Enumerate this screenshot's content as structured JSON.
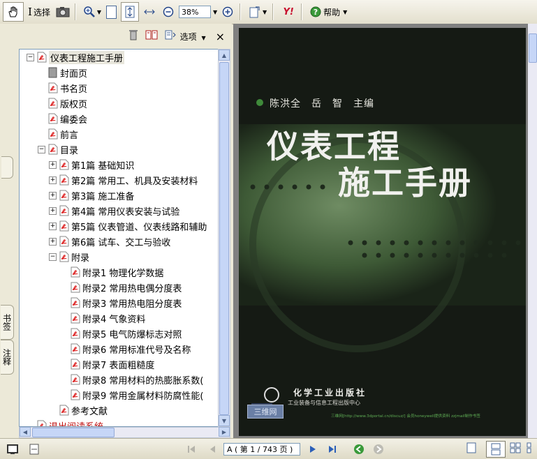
{
  "toolbar": {
    "hand_icon": "hand-icon",
    "select_label": "选择",
    "snapshot_icon": "camera-icon",
    "zoom_value": "38%",
    "help_label": "帮助",
    "yahoo_label": "Y!"
  },
  "panel": {
    "options_label": "选项",
    "close_label": "×",
    "tab_bookmarks": "书签",
    "tab_comments": "注释"
  },
  "tree": [
    {
      "label": "仪表工程施工手册",
      "level": 0,
      "expander": "−",
      "icon": "pdf"
    },
    {
      "label": "封面页",
      "level": 1,
      "expander": "",
      "icon": "page"
    },
    {
      "label": "书名页",
      "level": 1,
      "expander": "",
      "icon": "pdf"
    },
    {
      "label": "版权页",
      "level": 1,
      "expander": "",
      "icon": "pdf"
    },
    {
      "label": "编委会",
      "level": 1,
      "expander": "",
      "icon": "pdf"
    },
    {
      "label": "前言",
      "level": 1,
      "expander": "",
      "icon": "pdf"
    },
    {
      "label": "目录",
      "level": 1,
      "expander": "−",
      "icon": "pdf"
    },
    {
      "label": "第1篇 基础知识",
      "level": 2,
      "expander": "+",
      "icon": "pdf"
    },
    {
      "label": "第2篇 常用工、机具及安装材料",
      "level": 2,
      "expander": "+",
      "icon": "pdf"
    },
    {
      "label": "第3篇 施工准备",
      "level": 2,
      "expander": "+",
      "icon": "pdf"
    },
    {
      "label": "第4篇 常用仪表安装与试验",
      "level": 2,
      "expander": "+",
      "icon": "pdf"
    },
    {
      "label": "第5篇 仪表管道、仪表线路和辅助",
      "level": 2,
      "expander": "+",
      "icon": "pdf"
    },
    {
      "label": "第6篇 试车、交工与验收",
      "level": 2,
      "expander": "+",
      "icon": "pdf"
    },
    {
      "label": "附录",
      "level": 2,
      "expander": "−",
      "icon": "pdf"
    },
    {
      "label": "附录1 物理化学数据",
      "level": 3,
      "expander": "",
      "icon": "pdf"
    },
    {
      "label": "附录2 常用热电偶分度表",
      "level": 3,
      "expander": "",
      "icon": "pdf"
    },
    {
      "label": "附录3 常用热电阻分度表",
      "level": 3,
      "expander": "",
      "icon": "pdf"
    },
    {
      "label": "附录4 气象资料",
      "level": 3,
      "expander": "",
      "icon": "pdf"
    },
    {
      "label": "附录5 电气防爆标志对照",
      "level": 3,
      "expander": "",
      "icon": "pdf"
    },
    {
      "label": "附录6 常用标准代号及名称",
      "level": 3,
      "expander": "",
      "icon": "pdf"
    },
    {
      "label": "附录7 表面粗糙度",
      "level": 3,
      "expander": "",
      "icon": "pdf"
    },
    {
      "label": "附录8 常用材料的热膨胀系数(",
      "level": 3,
      "expander": "",
      "icon": "pdf"
    },
    {
      "label": "附录9 常用金属材料防腐性能(",
      "level": 3,
      "expander": "",
      "icon": "pdf"
    },
    {
      "label": "参考文献",
      "level": 2,
      "expander": "",
      "icon": "pdf"
    },
    {
      "label": "退出阅读系统",
      "level": 0,
      "expander": "",
      "icon": "pdf"
    }
  ],
  "cover": {
    "authors": "陈洪全　岳　智　主编",
    "title_line1": "仪表工程",
    "title_line2": "施工手册",
    "publisher": "化学工业出版社",
    "publisher_sub": "工业装备与信息工程出版中心",
    "stamp": "三维网",
    "footer_note": "三维网[http://www.3dportal.cn/discuz/] 会员honeywell提供资料 zzjmail制作书签"
  },
  "statusbar": {
    "page_display": "A ( 第 1 / 743 页 )"
  }
}
